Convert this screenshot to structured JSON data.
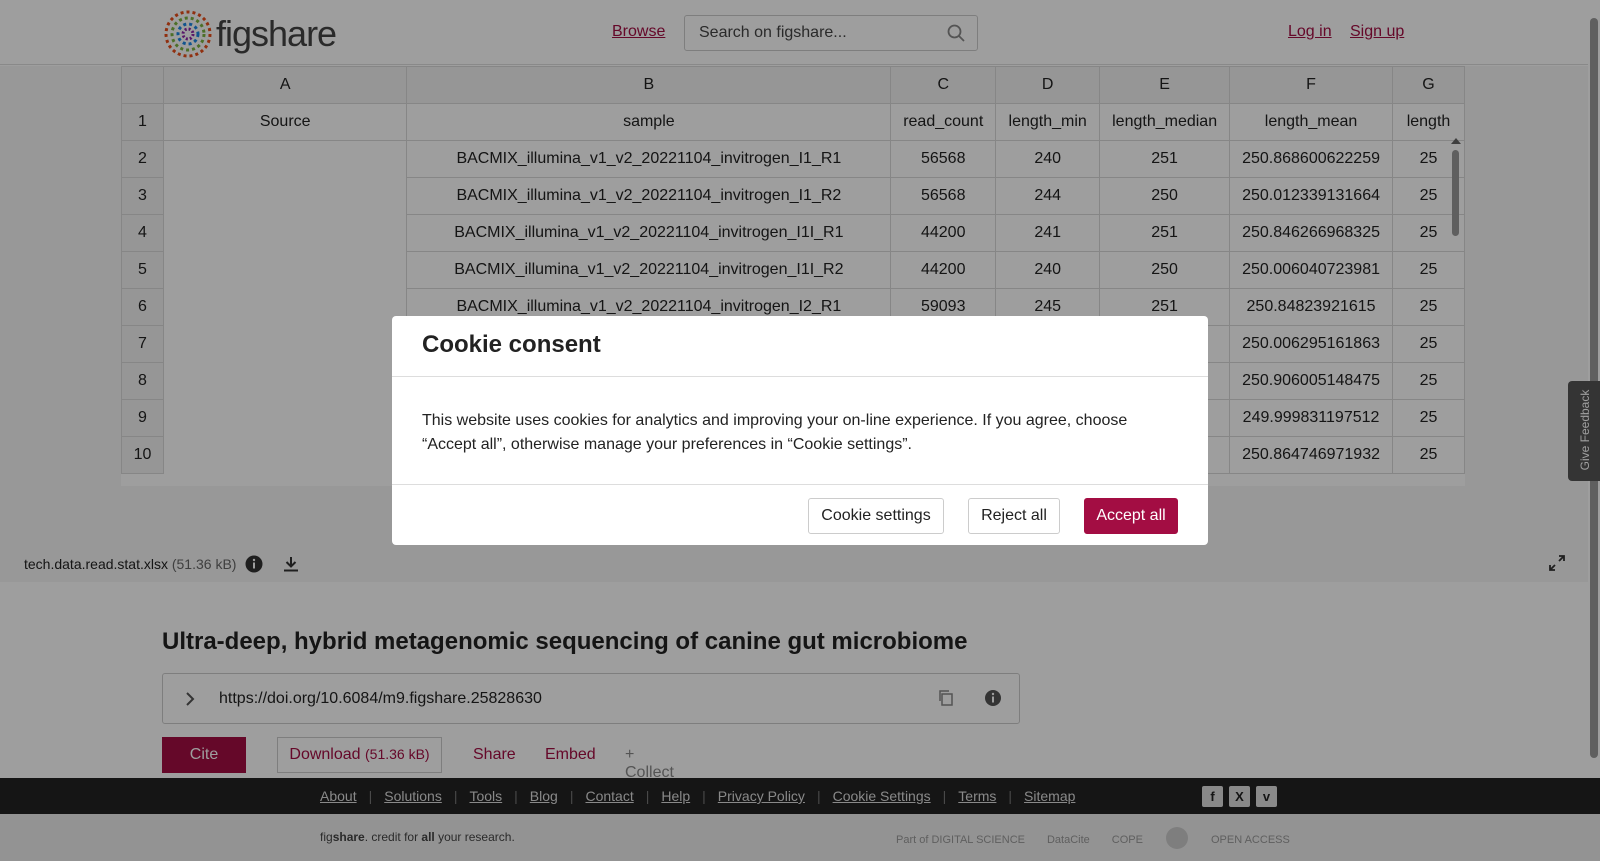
{
  "header": {
    "logo_text": "figshare",
    "browse_label": "Browse",
    "search_placeholder": "Search on figshare...",
    "login_label": "Log in",
    "signup_label": "Sign up"
  },
  "spreadsheet": {
    "column_letters": [
      "",
      "A",
      "B",
      "C",
      "D",
      "E",
      "F",
      "G"
    ],
    "rows": [
      {
        "num": "1",
        "cells": [
          "Source",
          "sample",
          "read_count",
          "length_min",
          "length_median",
          "length_mean",
          "length"
        ]
      },
      {
        "num": "2",
        "cells": [
          "",
          "BACMIX_illumina_v1_v2_20221104_invitrogen_I1_R1",
          "56568",
          "240",
          "251",
          "250.868600622259",
          "25"
        ]
      },
      {
        "num": "3",
        "cells": [
          "",
          "BACMIX_illumina_v1_v2_20221104_invitrogen_I1_R2",
          "56568",
          "244",
          "250",
          "250.012339131664",
          "25"
        ]
      },
      {
        "num": "4",
        "cells": [
          "",
          "BACMIX_illumina_v1_v2_20221104_invitrogen_I1I_R1",
          "44200",
          "241",
          "251",
          "250.846266968325",
          "25"
        ]
      },
      {
        "num": "5",
        "cells": [
          "",
          "BACMIX_illumina_v1_v2_20221104_invitrogen_I1I_R2",
          "44200",
          "240",
          "250",
          "250.006040723981",
          "25"
        ]
      },
      {
        "num": "6",
        "cells": [
          "",
          "BACMIX_illumina_v1_v2_20221104_invitrogen_I2_R1",
          "59093",
          "245",
          "251",
          "250.84823921615",
          "25"
        ]
      },
      {
        "num": "7",
        "cells": [
          "",
          "",
          "",
          "",
          "",
          "250.006295161863",
          "25"
        ]
      },
      {
        "num": "8",
        "cells": [
          "",
          "",
          "",
          "",
          "",
          "250.906005148475",
          "25"
        ]
      },
      {
        "num": "9",
        "cells": [
          "",
          "",
          "",
          "",
          "",
          "249.999831197512",
          "25"
        ]
      },
      {
        "num": "10",
        "cells": [
          "",
          "",
          "",
          "",
          "",
          "250.864746971932",
          "25"
        ]
      }
    ]
  },
  "file": {
    "name": "tech.data.read.stat.xlsx",
    "size": "(51.36 kB)"
  },
  "feedback_label": "Give Feedback",
  "item": {
    "title": "Ultra-deep, hybrid metagenomic sequencing of canine gut microbiome",
    "doi": "https://doi.org/10.6084/m9.figshare.25828630",
    "cite_label": "Cite",
    "download_label": "Download",
    "download_size": "(51.36 kB)",
    "share_label": "Share",
    "embed_label": "Embed",
    "collect_label": "+ Collect"
  },
  "footer": {
    "links": [
      "About",
      "Solutions",
      "Tools",
      "Blog",
      "Contact",
      "Help",
      "Privacy Policy",
      "Cookie Settings",
      "Terms",
      "Sitemap"
    ],
    "tagline_parts": [
      "fig",
      "share",
      ". credit for ",
      "all",
      " your research."
    ],
    "partners": [
      "Part of DIGITAL SCIENCE",
      "DataCite",
      "COPE",
      "",
      "OPEN ACCESS"
    ],
    "social_icons": [
      "facebook-icon",
      "x-icon",
      "vimeo-icon"
    ]
  },
  "cookie_modal": {
    "title": "Cookie consent",
    "body": "This website uses cookies for analytics and improving your on-line experience. If you agree, choose “Accept all”, otherwise manage your preferences in “Cookie settings”.",
    "settings_label": "Cookie settings",
    "reject_label": "Reject all",
    "accept_label": "Accept all"
  },
  "colors": {
    "brand": "#a30d43",
    "footer_dark": "#222222"
  }
}
